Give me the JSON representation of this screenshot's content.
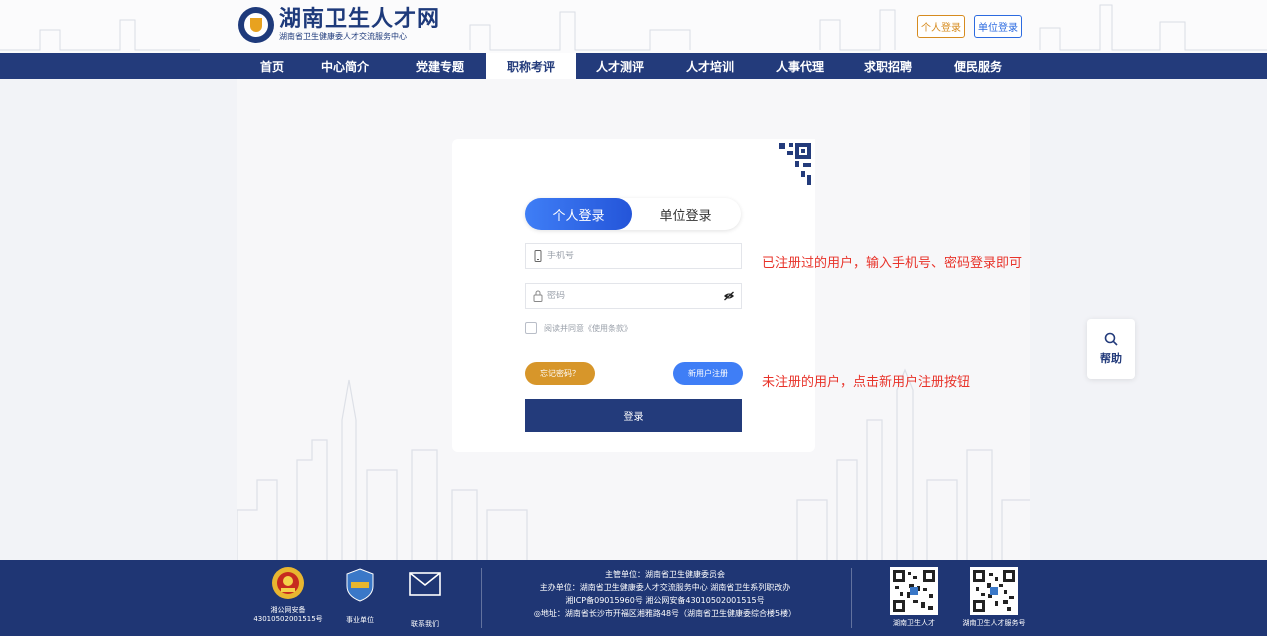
{
  "header": {
    "site_title": "湖南卫生人才网",
    "site_subtitle": "湖南省卫生健康委人才交流服务中心",
    "personal_login": "个人登录",
    "unit_login": "单位登录"
  },
  "nav": {
    "items": [
      {
        "label": "首页"
      },
      {
        "label": "中心简介"
      },
      {
        "label": "党建专题"
      },
      {
        "label": "职称考评"
      },
      {
        "label": "人才测评"
      },
      {
        "label": "人才培训"
      },
      {
        "label": "人事代理"
      },
      {
        "label": "求职招聘"
      },
      {
        "label": "便民服务"
      }
    ],
    "active": "职称考评"
  },
  "login": {
    "tab_personal": "个人登录",
    "tab_unit": "单位登录",
    "phone_placeholder": "手机号",
    "password_placeholder": "密码",
    "agree_text": "阅读并同意《使用条款》",
    "forgot_label": "忘记密码？",
    "register_label": "新用户注册",
    "submit_label": "登录"
  },
  "notes": {
    "registered": "已注册过的用户，输入手机号、密码登录即可",
    "unregistered": "未注册的用户，点击新用户注册按钮"
  },
  "help": {
    "label": "帮助"
  },
  "footer": {
    "police_label_1": "湘公网安备",
    "police_label_2": "43010502001515号",
    "unit_label": "事业单位",
    "contact_label": "联系我们",
    "info": {
      "line1": "主管单位：湖南省卫生健康委员会",
      "line2": "主办单位：湖南省卫生健康委人才交流服务中心 湖南省卫生系列职改办",
      "line3": "湘ICP备09015960号 湘公网安备43010502001515号",
      "line4": "◎地址：湖南省长沙市开福区湘雅路48号（湖南省卫生健康委综合楼5楼）"
    },
    "qr1_label": "湖南卫生人才",
    "qr2_label": "湖南卫生人才服务号"
  },
  "colors": {
    "primary": "#233b7b",
    "accent_blue": "#3f7ef6",
    "accent_orange": "#d7962a",
    "note_red": "#e8332a"
  }
}
